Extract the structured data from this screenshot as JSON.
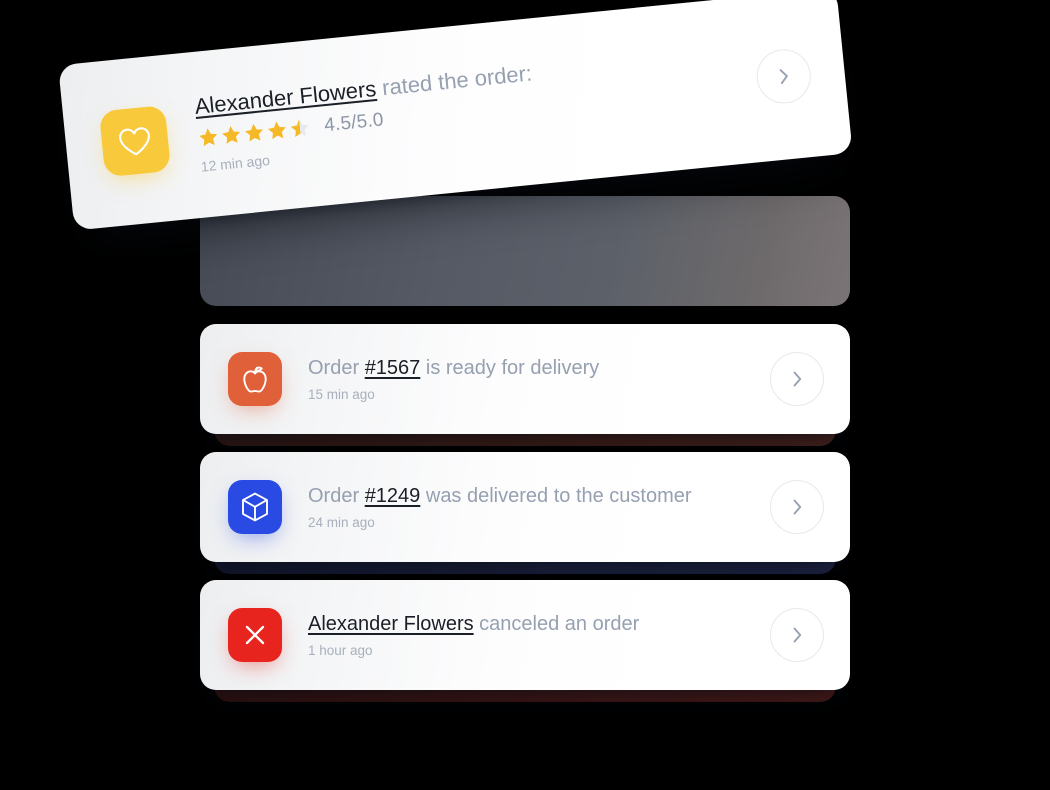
{
  "background_color": "#000000",
  "colors": {
    "card_bg": "#ffffff",
    "muted_text": "#96a0b0",
    "strong_text": "#1b1f27",
    "timestamp_text": "#a8b0bd",
    "tile_yellow": "#f9c93c",
    "tile_orange": "#e0603a",
    "tile_blue": "#2a4ae4",
    "tile_red": "#e8241f",
    "star_filled": "#f5b928",
    "star_empty": "#e7e9ec",
    "chevron_border": "#e6e8ec",
    "chevron_glyph": "#97a1b2",
    "slate_card": "#555a64"
  },
  "notifications": [
    {
      "id": "rating",
      "icon": "heart-icon",
      "icon_tile_color": "#f9c93c",
      "headline_strong": "Alexander Flowers",
      "headline_rest": " rated the order:",
      "rating_value": "4.5/5.0",
      "rating_stars": 4.5,
      "rating_max": 5,
      "timestamp": "12 min ago",
      "chevron": "chevron-right-icon"
    },
    {
      "id": "ready",
      "icon": "apple-icon",
      "icon_tile_color": "#e0603a",
      "headline_prefix": "Order ",
      "headline_strong": "#1567",
      "headline_rest": " is ready for delivery",
      "timestamp": "15 min ago",
      "chevron": "chevron-right-icon"
    },
    {
      "id": "delivered",
      "icon": "package-box-icon",
      "icon_tile_color": "#2a4ae4",
      "headline_prefix": "Order ",
      "headline_strong": "#1249",
      "headline_rest": " was delivered to the customer",
      "timestamp": "24 min ago",
      "chevron": "chevron-right-icon"
    },
    {
      "id": "canceled",
      "icon": "close-x-icon",
      "icon_tile_color": "#e8241f",
      "headline_prefix": "",
      "headline_strong": "Alexander Flowers",
      "headline_rest": " canceled an order",
      "timestamp": "1 hour ago",
      "chevron": "chevron-right-icon"
    }
  ]
}
